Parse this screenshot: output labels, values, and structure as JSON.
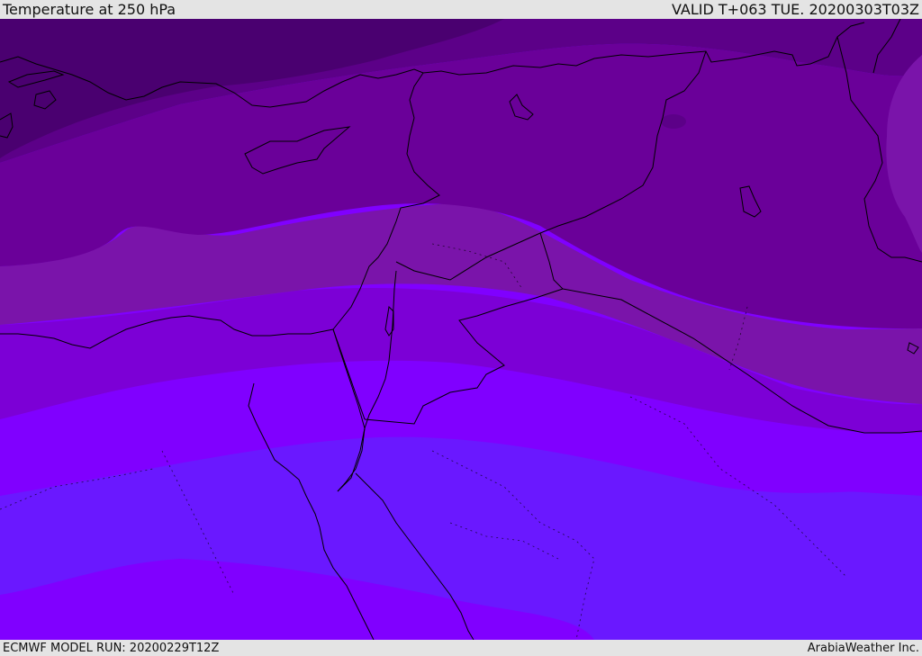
{
  "header": {
    "title": "Temperature at 250 hPa",
    "valid": "VALID T+063 TUE. 20200303T03Z"
  },
  "footer": {
    "model_run": "ECMWF MODEL RUN: 20200229T12Z",
    "credit": "ArabiaWeather Inc."
  },
  "map": {
    "variable": "Temperature",
    "level": "250 hPa",
    "palette": {
      "coldest": "#4a0070",
      "band_2": "#5c0088",
      "band_3": "#6a0099",
      "band_4": "#7a14aa",
      "band_5": "#7c00d6",
      "band_6": "#8000ff",
      "band_7": "#6a18ff",
      "coast": "#000000"
    }
  }
}
